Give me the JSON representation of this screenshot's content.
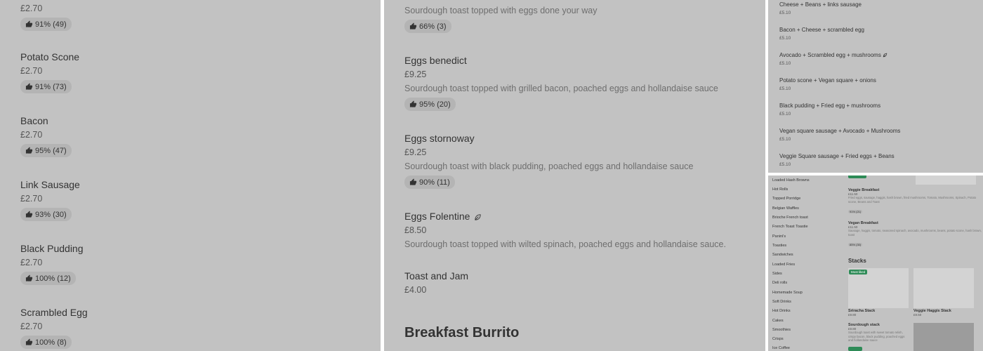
{
  "panel1": {
    "top_price": "£2.70",
    "top_rating": "91% (49)",
    "items": [
      {
        "name": "Potato Scone",
        "price": "£2.70",
        "rating": "91% (73)"
      },
      {
        "name": "Bacon",
        "price": "£2.70",
        "rating": "95% (47)"
      },
      {
        "name": "Link Sausage",
        "price": "£2.70",
        "rating": "93% (30)"
      },
      {
        "name": "Black Pudding",
        "price": "£2.70",
        "rating": "100% (12)"
      },
      {
        "name": "Scrambled Egg",
        "price": "£2.70",
        "rating": "100% (8)"
      }
    ]
  },
  "panel2": {
    "top_desc": "Sourdough toast topped with eggs done your way",
    "top_rating": "66% (3)",
    "items": [
      {
        "name": "Eggs benedict",
        "price": "£9.25",
        "desc": "Sourdough toast topped with grilled bacon, poached eggs and hollandaise sauce",
        "rating": "95% (20)"
      },
      {
        "name": "Eggs stornoway",
        "price": "£9.25",
        "desc": "Sourdough toast with black pudding, poached eggs and hollandaise sauce",
        "rating": "90% (11)"
      },
      {
        "name": "Eggs Folentine",
        "price": "£8.50",
        "desc": "Sourdough toast topped with wilted spinach, poached eggs and hollandaise sauce."
      },
      {
        "name": "Toast and Jam",
        "price": "£4.00"
      }
    ],
    "section_title": "Breakfast Burrito"
  },
  "panel3": {
    "combos": [
      {
        "name": "Cheese + Beans + links sausage",
        "price": "£5.10"
      },
      {
        "name": "Bacon + Cheese + scrambled egg",
        "price": "£5.10"
      },
      {
        "name": "Avocado + Scrambled egg + mushrooms",
        "price": "£5.10"
      },
      {
        "name": "Potato scone + Vegan square + onions",
        "price": "£5.10"
      },
      {
        "name": "Black pudding + Fried egg + mushrooms",
        "price": "£5.10"
      },
      {
        "name": "Vegan square sausage + Avocado + Mushrooms",
        "price": "£5.10"
      },
      {
        "name": "Veggie Square sausage + Fried eggs + Beans",
        "price": "£5.10"
      }
    ]
  },
  "panel4": {
    "sidebar": [
      "Loaded Hash Browns",
      "Hot Rolls",
      "Topped Porridge",
      "Belgian Waffles",
      "Brioche French toast",
      "French Toast Toastie",
      "Panini's",
      "Toasties",
      "Sandwiches",
      "Loaded Fries",
      "Sides",
      "Deli rolls",
      "Homemade Soup",
      "Soft Drinks",
      "Hot Drinks",
      "Cakes",
      "Smoothies",
      "Crisps",
      "Ice Coffee"
    ],
    "veggie_breakfast": {
      "name": "Veggie Breakfast",
      "price": "£11.50",
      "desc": "Fried eggs, sausage, haggis, hash brown, fried mushrooms, Tomato, Mushrooms, Spinach, Potato scone, Beans and Toast",
      "rating": "91% (21)"
    },
    "vegan_breakfast": {
      "name": "Vegan Breakfast",
      "price": "£11.50",
      "desc": "Sausage, haggis, tomato, seasoned spinach, avocado, mushrooms, beans, potato scone, hash brown, toast",
      "rating": "85% (30)"
    },
    "stacks_title": "Stacks",
    "tag": "Most liked",
    "stack1": {
      "name": "Sriracha Stack",
      "price": "£9.80"
    },
    "stack2": {
      "name": "Veggie Haggis Stack",
      "price": "£9.50"
    },
    "stack3": {
      "name": "Sourdough stack",
      "price": "£9.80",
      "desc": "Sourdough toast with sweet tomato relish, crispy bacon, black pudding, poached eggs and hollandaise sauce"
    }
  }
}
